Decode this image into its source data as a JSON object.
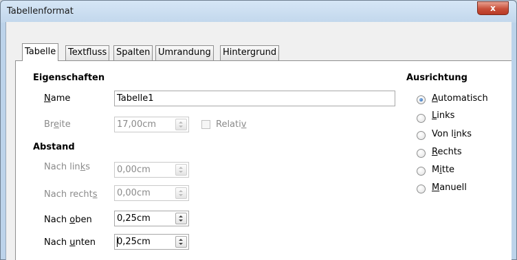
{
  "window": {
    "title": "Tabellenformat",
    "close_glyph": "x"
  },
  "tabs": [
    {
      "label": "Tabelle",
      "active": true
    },
    {
      "label": "Textfluss",
      "active": false
    },
    {
      "label": "Spalten",
      "active": false
    },
    {
      "label": "Umrandung",
      "active": false
    },
    {
      "label": "Hintergrund",
      "active": false
    }
  ],
  "eigenschaften": {
    "heading": "Eigenschaften",
    "name": {
      "label_pre": "",
      "label_mn": "N",
      "label_post": "ame",
      "value": "Tabelle1"
    },
    "breite": {
      "label_pre": "Br",
      "label_mn": "e",
      "label_post": "ite",
      "value": "17,00cm",
      "enabled": false
    },
    "relativ": {
      "label_pre": "Relati",
      "label_mn": "v",
      "label_post": "",
      "checked": false,
      "enabled": false
    }
  },
  "abstand": {
    "heading": "Abstand",
    "nach_links": {
      "label_pre": "Nach lin",
      "label_mn": "k",
      "label_post": "s",
      "value": "0,00cm",
      "enabled": false
    },
    "nach_rechts": {
      "label_pre": "Nach recht",
      "label_mn": "s",
      "label_post": "",
      "value": "0,00cm",
      "enabled": false
    },
    "nach_oben": {
      "label_pre": "Nach ",
      "label_mn": "o",
      "label_post": "ben",
      "value": "0,25cm",
      "enabled": true
    },
    "nach_unten": {
      "label_pre": "Nach ",
      "label_mn": "u",
      "label_post": "nten",
      "value": "0,25cm",
      "enabled": true
    }
  },
  "ausrichtung": {
    "heading": "Ausrichtung",
    "options": [
      {
        "pre": "",
        "mn": "A",
        "post": "utomatisch",
        "checked": true
      },
      {
        "pre": "",
        "mn": "L",
        "post": "inks",
        "checked": false
      },
      {
        "pre": "Von l",
        "mn": "i",
        "post": "nks",
        "checked": false
      },
      {
        "pre": "",
        "mn": "R",
        "post": "echts",
        "checked": false
      },
      {
        "pre": "M",
        "mn": "i",
        "post": "tte",
        "checked": false
      },
      {
        "pre": "",
        "mn": "M",
        "post": "anuell",
        "checked": false
      }
    ]
  }
}
